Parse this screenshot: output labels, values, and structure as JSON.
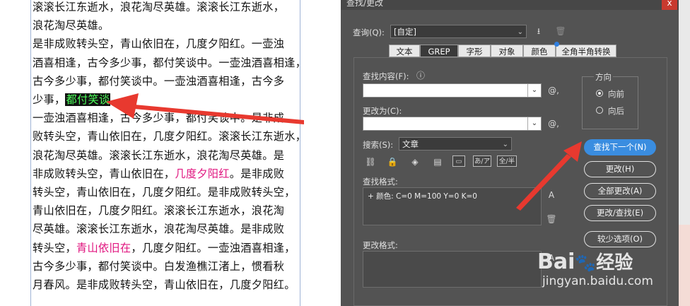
{
  "document": {
    "lines": [
      [
        {
          "t": "滚滚长江东逝水，浪花淘尽英雄。滚滚长江东逝水，"
        }
      ],
      [
        {
          "t": "浪花淘尽英雄。"
        }
      ],
      [
        {
          "t": "是非成败转头空，青山依旧在，几度夕阳红。一壶浊"
        }
      ],
      [
        {
          "t": "酒喜相逢，古今多少事，都付笑谈中。一壶浊酒喜相逢，"
        }
      ],
      [
        {
          "t": "古今多少事，都付笑谈中。一壶浊酒喜相逢，古今多"
        }
      ],
      [
        {
          "t": "少事，"
        },
        {
          "t": "都付笑谈",
          "s": "hl"
        }
      ],
      [
        {
          "t": "一壶浊酒喜相逢，古今多少事，都付笑谈中。是非成"
        }
      ],
      [
        {
          "t": "败转头空，青山依旧在，几度夕阳红。滚滚长江东逝水，"
        }
      ],
      [
        {
          "t": "浪花淘尽英雄。滚滚长江东逝水，浪花淘尽英雄。是"
        }
      ],
      [
        {
          "t": "非成败转头空，青山依旧在，"
        },
        {
          "t": "几度夕阳红",
          "s": "mag"
        },
        {
          "t": "。是非成败"
        }
      ],
      [
        {
          "t": "转头空，青山依旧在，几度夕阳红。是非成败转头空，"
        }
      ],
      [
        {
          "t": "青山依旧在，几度夕阳红。滚滚长江东逝水，浪花淘"
        }
      ],
      [
        {
          "t": "尽英雄。滚滚长江东逝水，浪花淘尽英雄。是非成败"
        }
      ],
      [
        {
          "t": "转头空，"
        },
        {
          "t": "青山依旧在",
          "s": "mag"
        },
        {
          "t": "，几度夕阳红。一壶浊酒喜相逢，"
        }
      ],
      [
        {
          "t": "古今多少事，都付笑谈中。白发渔樵江渚上，惯看秋"
        }
      ],
      [
        {
          "t": "月春风。是非成败转头空，青山依旧在，几度夕阳红。"
        }
      ]
    ]
  },
  "dialog": {
    "title": "查找/更改",
    "close_glyph": "x",
    "query_label": "查询(Q):",
    "query_value": "[自定]",
    "tabs": [
      "文本",
      "GREP",
      "字形",
      "对象",
      "颜色",
      "全角半角转换"
    ],
    "active_tab": "GREP",
    "find_label": "查找内容(F):",
    "change_label": "更改为(C):",
    "search_label": "搜索(S):",
    "search_value": "文章",
    "direction_label": "方向",
    "forward_label": "向前",
    "backward_label": "向后",
    "find_format_label": "查找格式:",
    "find_format_value": "+ 颜色: C=0 M=100 Y=0 K=0",
    "change_format_label": "更改格式:",
    "option_icons": [
      "あ/ア",
      "全/半"
    ],
    "buttons": {
      "find_next": "查找下一个(N)",
      "change": "更改(H)",
      "change_all": "全部更改(A)",
      "change_find": "更改/查找(E)",
      "fewer_options": "较少选项(O)"
    }
  },
  "watermark": {
    "brand_a": "Bai",
    "brand_b": "经验",
    "url": "jingyan.baidu.com"
  },
  "colors": {
    "arrow": "#e8392f",
    "primary_button": "#3a8de0",
    "highlight_text": "#4cff5a",
    "magenta_text": "#e0157f"
  }
}
